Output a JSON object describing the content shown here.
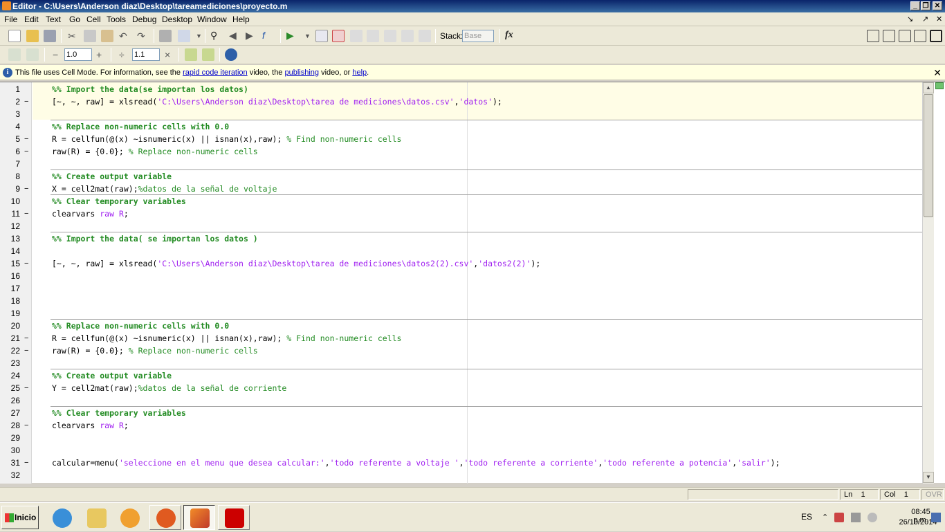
{
  "window": {
    "title": "Editor - C:\\Users\\Anderson diaz\\Desktop\\tareamediciones\\proyecto.m",
    "minimize": "_",
    "restore": "❐",
    "close": "✕"
  },
  "menu": {
    "items": [
      "File",
      "Edit",
      "Text",
      "Go",
      "Cell",
      "Tools",
      "Debug",
      "Desktop",
      "Window",
      "Help"
    ],
    "right_controls": [
      "↘",
      "↗",
      "✕"
    ]
  },
  "toolbar": {
    "stack_label": "Stack:",
    "stack_value": "Base",
    "fx_label": "fx",
    "cell_minus": "−",
    "cell_value1": "1.0",
    "cell_plus": "+",
    "cell_divide": "÷",
    "cell_value2": "1.1",
    "cell_times": "×"
  },
  "infobar": {
    "text1": "This file uses Cell Mode. For information, see the ",
    "link1": "rapid code iteration",
    "text2": " video, the ",
    "link2": "publishing",
    "text3": " video, or ",
    "link3": "help",
    "text4": ".",
    "close": "✕"
  },
  "editor": {
    "lines": [
      {
        "n": "1",
        "dash": "",
        "parts": [
          {
            "t": "%% Import the data(se importan los datos)",
            "c": "cmt-cell"
          }
        ]
      },
      {
        "n": "2",
        "dash": "−",
        "parts": [
          {
            "t": "[~, ~, raw] = xlsread(",
            "c": ""
          },
          {
            "t": "'C:\\Users\\Anderson diaz\\Desktop\\tarea de mediciones\\datos.csv'",
            "c": "str"
          },
          {
            "t": ",",
            "c": ""
          },
          {
            "t": "'datos'",
            "c": "str"
          },
          {
            "t": ");",
            "c": ""
          }
        ]
      },
      {
        "n": "3",
        "dash": "",
        "parts": []
      },
      {
        "n": "4",
        "dash": "",
        "parts": [
          {
            "t": "%% Replace non-numeric cells with 0.0",
            "c": "cmt-cell"
          }
        ]
      },
      {
        "n": "5",
        "dash": "−",
        "parts": [
          {
            "t": "R = cellfun(@(x) ~isnumeric(x) || isnan(x),raw); ",
            "c": ""
          },
          {
            "t": "% Find non-numeric cells",
            "c": "cmt"
          }
        ]
      },
      {
        "n": "6",
        "dash": "−",
        "parts": [
          {
            "t": "raw(R) = {0.0}; ",
            "c": ""
          },
          {
            "t": "% Replace non-numeric cells",
            "c": "cmt"
          }
        ]
      },
      {
        "n": "7",
        "dash": "",
        "parts": []
      },
      {
        "n": "8",
        "dash": "",
        "parts": [
          {
            "t": "%% Create output variable",
            "c": "cmt-cell"
          }
        ]
      },
      {
        "n": "9",
        "dash": "−",
        "parts": [
          {
            "t": "X = cell2mat(raw);",
            "c": ""
          },
          {
            "t": "%datos de la señal de voltaje",
            "c": "cmt"
          }
        ]
      },
      {
        "n": "10",
        "dash": "",
        "parts": [
          {
            "t": "%% Clear temporary variables",
            "c": "cmt-cell"
          }
        ]
      },
      {
        "n": "11",
        "dash": "−",
        "parts": [
          {
            "t": "clearvars ",
            "c": ""
          },
          {
            "t": "raw R",
            "c": "str"
          },
          {
            "t": ";",
            "c": ""
          }
        ]
      },
      {
        "n": "12",
        "dash": "",
        "parts": []
      },
      {
        "n": "13",
        "dash": "",
        "parts": [
          {
            "t": "%% Import the data( se importan los datos )",
            "c": "cmt-cell"
          }
        ]
      },
      {
        "n": "14",
        "dash": "",
        "parts": []
      },
      {
        "n": "15",
        "dash": "−",
        "parts": [
          {
            "t": "[~, ~, raw] = xlsread(",
            "c": ""
          },
          {
            "t": "'C:\\Users\\Anderson diaz\\Desktop\\tarea de mediciones\\datos2(2).csv'",
            "c": "str"
          },
          {
            "t": ",",
            "c": ""
          },
          {
            "t": "'datos2(2)'",
            "c": "str"
          },
          {
            "t": ");",
            "c": ""
          }
        ]
      },
      {
        "n": "16",
        "dash": "",
        "parts": []
      },
      {
        "n": "17",
        "dash": "",
        "parts": []
      },
      {
        "n": "18",
        "dash": "",
        "parts": []
      },
      {
        "n": "19",
        "dash": "",
        "parts": []
      },
      {
        "n": "20",
        "dash": "",
        "parts": [
          {
            "t": "%% Replace non-numeric cells with 0.0",
            "c": "cmt-cell"
          }
        ]
      },
      {
        "n": "21",
        "dash": "−",
        "parts": [
          {
            "t": "R = cellfun(@(x) ~isnumeric(x) || isnan(x),raw); ",
            "c": ""
          },
          {
            "t": "% Find non-numeric cells",
            "c": "cmt"
          }
        ]
      },
      {
        "n": "22",
        "dash": "−",
        "parts": [
          {
            "t": "raw(R) = {0.0}; ",
            "c": ""
          },
          {
            "t": "% Replace non-numeric cells",
            "c": "cmt"
          }
        ]
      },
      {
        "n": "23",
        "dash": "",
        "parts": []
      },
      {
        "n": "24",
        "dash": "",
        "parts": [
          {
            "t": "%% Create output variable",
            "c": "cmt-cell"
          }
        ]
      },
      {
        "n": "25",
        "dash": "−",
        "parts": [
          {
            "t": "Y = cell2mat(raw);",
            "c": ""
          },
          {
            "t": "%datos de la señal de corriente",
            "c": "cmt"
          }
        ]
      },
      {
        "n": "26",
        "dash": "",
        "parts": []
      },
      {
        "n": "27",
        "dash": "",
        "parts": [
          {
            "t": "%% Clear temporary variables",
            "c": "cmt-cell"
          }
        ]
      },
      {
        "n": "28",
        "dash": "−",
        "parts": [
          {
            "t": "clearvars ",
            "c": ""
          },
          {
            "t": "raw R",
            "c": "str"
          },
          {
            "t": ";",
            "c": ""
          }
        ]
      },
      {
        "n": "29",
        "dash": "",
        "parts": []
      },
      {
        "n": "30",
        "dash": "",
        "parts": []
      },
      {
        "n": "31",
        "dash": "−",
        "parts": [
          {
            "t": "calcular=menu(",
            "c": ""
          },
          {
            "t": "'seleccione en el menu que desea calcular:'",
            "c": "str"
          },
          {
            "t": ",",
            "c": ""
          },
          {
            "t": "'todo referente a voltaje '",
            "c": "str"
          },
          {
            "t": ",",
            "c": ""
          },
          {
            "t": "'todo referente a corriente'",
            "c": "str"
          },
          {
            "t": ",",
            "c": ""
          },
          {
            "t": "'todo referente a potencia'",
            "c": "str"
          },
          {
            "t": ",",
            "c": ""
          },
          {
            "t": "'salir'",
            "c": "str"
          },
          {
            "t": ");",
            "c": ""
          }
        ]
      },
      {
        "n": "32",
        "dash": "",
        "parts": []
      }
    ]
  },
  "statusbar": {
    "ln_label": "Ln",
    "ln_value": "1",
    "col_label": "Col",
    "col_value": "1",
    "ovr": "OVR"
  },
  "taskbar": {
    "start": "Inicio",
    "lang": "ES",
    "time": "08:45 p.m.",
    "date": "26/10/2014"
  },
  "colors": {
    "cell_comment": "#228b22",
    "string": "#a020f0",
    "comment": "#228b22",
    "cell_highlight": "#fffde6"
  }
}
